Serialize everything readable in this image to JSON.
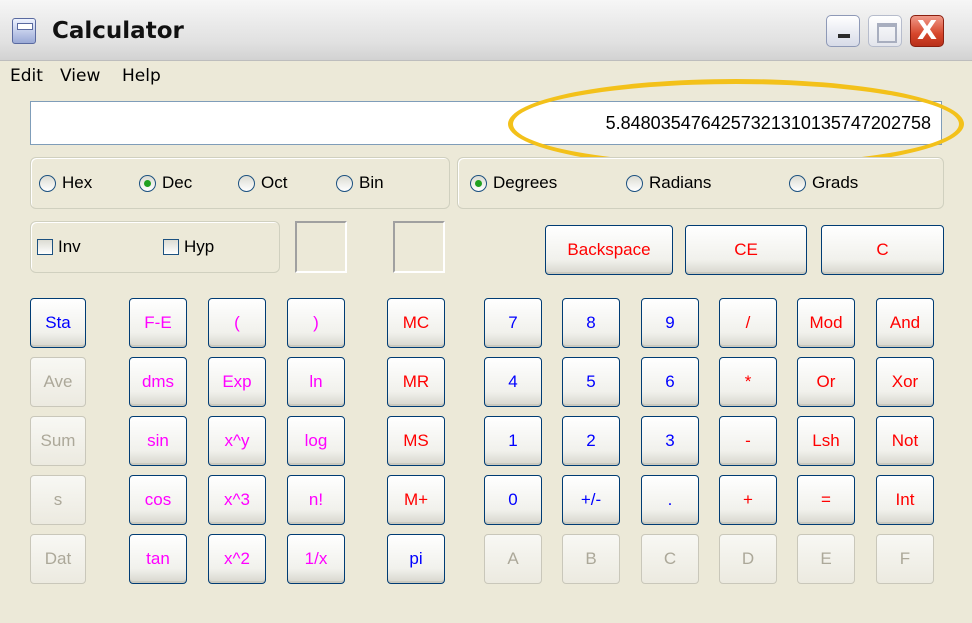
{
  "window": {
    "title": "Calculator"
  },
  "titlebar_buttons": {
    "close_glyph": "X"
  },
  "menu": [
    "Edit",
    "View",
    "Help"
  ],
  "display": {
    "value": "5.8480354764257321310135747202758"
  },
  "number_system": {
    "options": [
      "Hex",
      "Dec",
      "Oct",
      "Bin"
    ],
    "selected": "Dec"
  },
  "angle_units": {
    "options": [
      "Degrees",
      "Radians",
      "Grads"
    ],
    "selected": "Degrees"
  },
  "modifiers": {
    "inv": "Inv",
    "hyp": "Hyp"
  },
  "edit_buttons": {
    "backspace": "Backspace",
    "ce": "CE",
    "c": "C"
  },
  "stat_buttons": [
    "Sta",
    "Ave",
    "Sum",
    "s",
    "Dat"
  ],
  "function_buttons": [
    [
      "F-E",
      "(",
      ")"
    ],
    [
      "dms",
      "Exp",
      "ln"
    ],
    [
      "sin",
      "x^y",
      "log"
    ],
    [
      "cos",
      "x^3",
      "n!"
    ],
    [
      "tan",
      "x^2",
      "1/x"
    ]
  ],
  "memory_buttons": [
    "MC",
    "MR",
    "MS",
    "M+",
    "pi"
  ],
  "keypad": [
    [
      "7",
      "8",
      "9",
      "/",
      "Mod",
      "And"
    ],
    [
      "4",
      "5",
      "6",
      "*",
      "Or",
      "Xor"
    ],
    [
      "1",
      "2",
      "3",
      "-",
      "Lsh",
      "Not"
    ],
    [
      "0",
      "+/-",
      ".",
      "+",
      "=",
      "Int"
    ],
    [
      "A",
      "B",
      "C",
      "D",
      "E",
      "F"
    ]
  ],
  "colors": {
    "blue": "#0000ff",
    "red": "#ff0000",
    "magenta": "#ff00ff",
    "disabled": "#aca899",
    "highlight": "#f3c11a"
  }
}
